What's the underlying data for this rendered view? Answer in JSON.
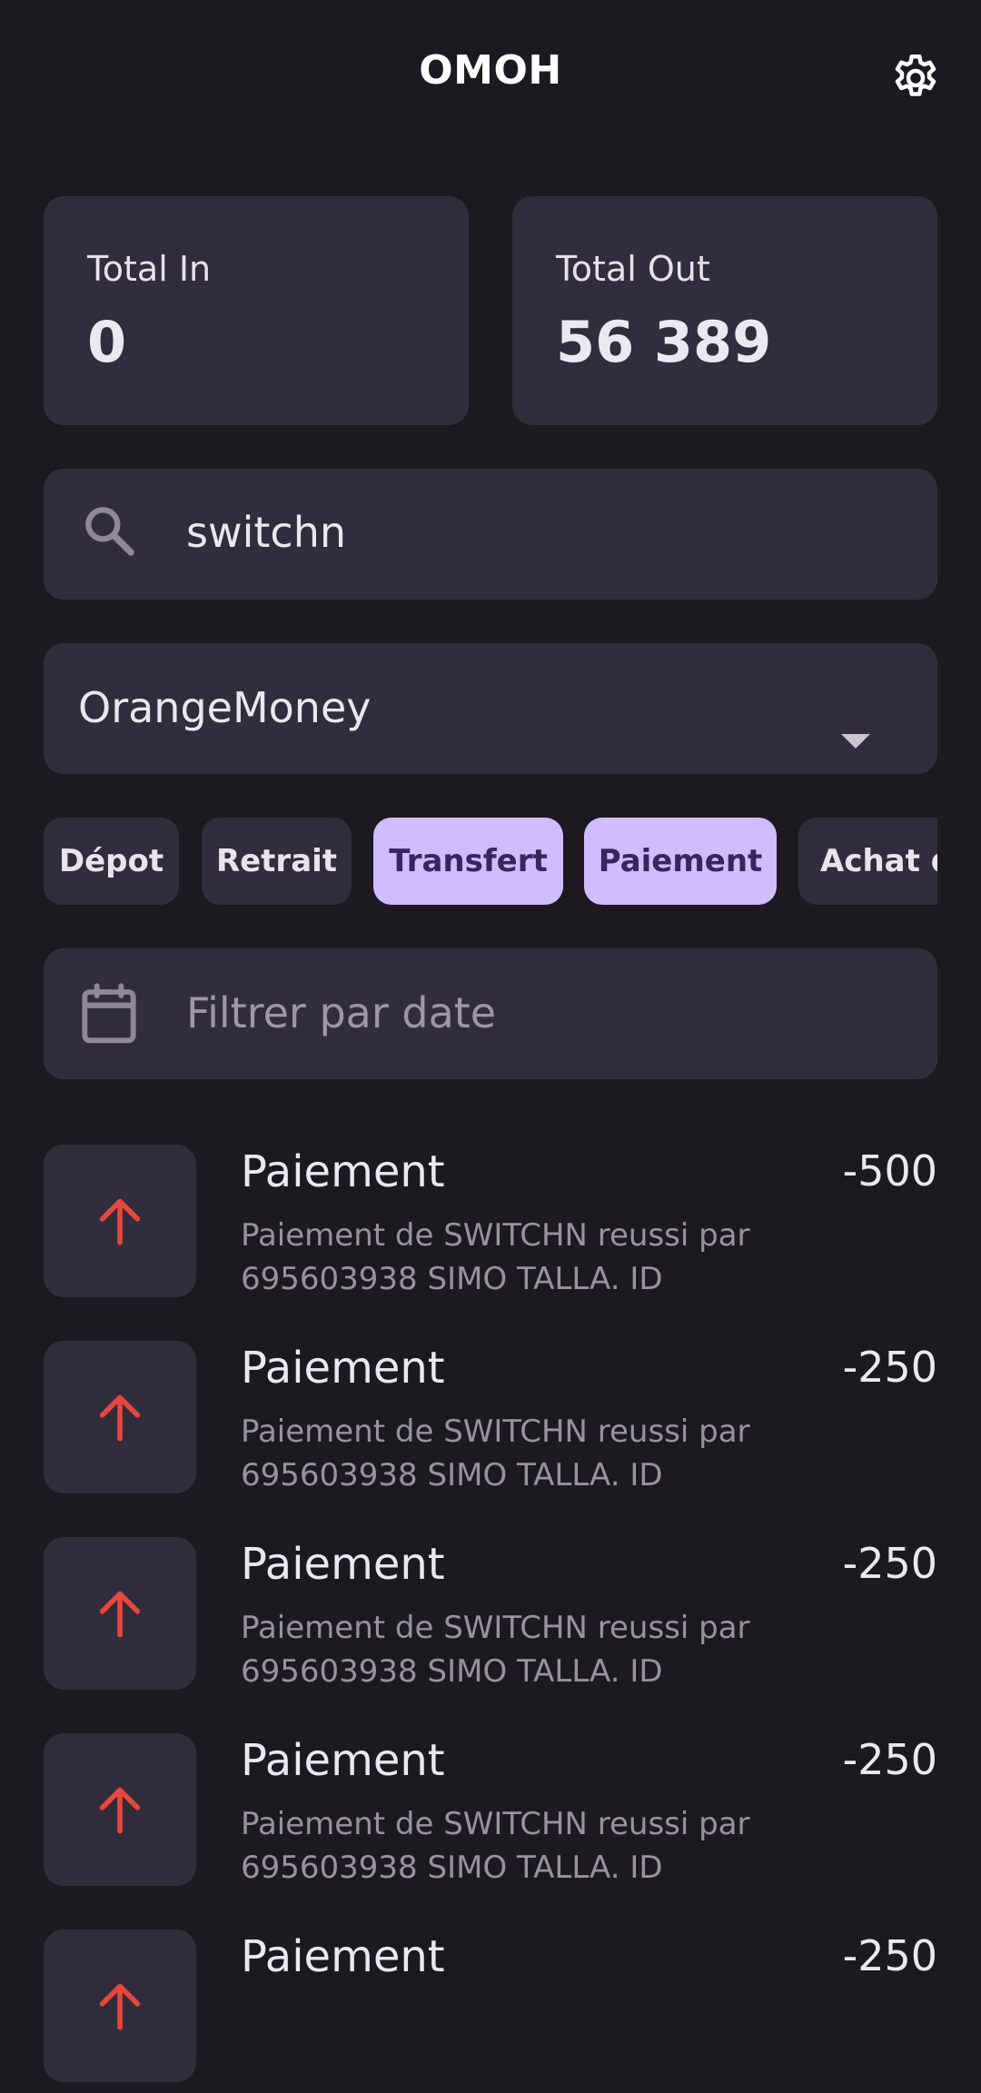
{
  "header": {
    "title": "OMOH",
    "settings_icon": "gear-icon"
  },
  "summary": {
    "total_in_label": "Total In",
    "total_in_value": "0",
    "total_out_label": "Total Out",
    "total_out_value": "56 389"
  },
  "search": {
    "value": "switchn",
    "icon": "search-icon"
  },
  "provider_select": {
    "selected": "OrangeMoney"
  },
  "chips": [
    {
      "label": "Dépot",
      "selected": false
    },
    {
      "label": "Retrait",
      "selected": false
    },
    {
      "label": "Transfert",
      "selected": true
    },
    {
      "label": "Paiement",
      "selected": true
    },
    {
      "label": "Achat d",
      "selected": false
    }
  ],
  "date_filter": {
    "placeholder": "Filtrer par date",
    "icon": "calendar-icon"
  },
  "transactions": [
    {
      "title": "Paiement",
      "amount": "-500",
      "desc_line1": "Paiement de SWITCHN reussi par",
      "desc_line2": "695603938 SIMO TALLA. ID",
      "icon": "arrow-up-icon"
    },
    {
      "title": "Paiement",
      "amount": "-250",
      "desc_line1": "Paiement de SWITCHN reussi par",
      "desc_line2": "695603938 SIMO TALLA. ID",
      "icon": "arrow-up-icon"
    },
    {
      "title": "Paiement",
      "amount": "-250",
      "desc_line1": "Paiement de SWITCHN reussi par",
      "desc_line2": "695603938 SIMO TALLA. ID",
      "icon": "arrow-up-icon"
    },
    {
      "title": "Paiement",
      "amount": "-250",
      "desc_line1": "Paiement de SWITCHN reussi par",
      "desc_line2": "695603938 SIMO TALLA. ID",
      "icon": "arrow-up-icon"
    },
    {
      "title": "Paiement",
      "amount": "-250",
      "desc_line1": "",
      "desc_line2": "",
      "icon": "arrow-up-icon"
    }
  ],
  "colors": {
    "background": "#1c1a20",
    "surface": "#312d3c",
    "chip_selected": "#d0bcfe",
    "outgoing_arrow": "#e8473c"
  }
}
